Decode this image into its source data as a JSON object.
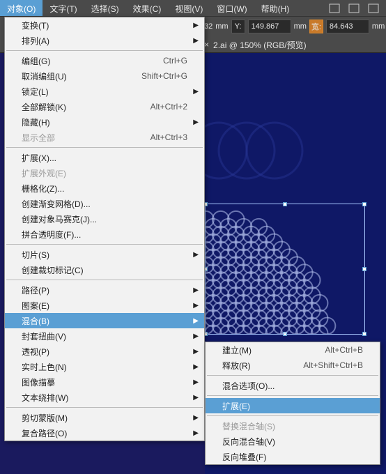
{
  "menubar": {
    "items": [
      {
        "label": "对象(O)",
        "active": true
      },
      {
        "label": "文字(T)"
      },
      {
        "label": "选择(S)"
      },
      {
        "label": "效果(C)"
      },
      {
        "label": "视图(V)"
      },
      {
        "label": "窗口(W)"
      },
      {
        "label": "帮助(H)"
      }
    ]
  },
  "toolbar": {
    "x_suffix": "32",
    "unit": "mm",
    "y_label": "Y:",
    "y_value": "149.867",
    "w_label": "宽:",
    "w_value": "84.643",
    "tab_close": "×",
    "tab_name": "2.ai @ 150% (RGB/预览)"
  },
  "dropdown": {
    "sections": [
      [
        {
          "label": "变换(T)",
          "sub": true
        },
        {
          "label": "排列(A)",
          "sub": true
        }
      ],
      [
        {
          "label": "编组(G)",
          "shortcut": "Ctrl+G"
        },
        {
          "label": "取消编组(U)",
          "shortcut": "Shift+Ctrl+G"
        },
        {
          "label": "锁定(L)",
          "sub": true
        },
        {
          "label": "全部解锁(K)",
          "shortcut": "Alt+Ctrl+2"
        },
        {
          "label": "隐藏(H)",
          "sub": true
        },
        {
          "label": "显示全部",
          "shortcut": "Alt+Ctrl+3",
          "disabled": true
        }
      ],
      [
        {
          "label": "扩展(X)..."
        },
        {
          "label": "扩展外观(E)",
          "disabled": true
        },
        {
          "label": "栅格化(Z)..."
        },
        {
          "label": "创建渐变网格(D)..."
        },
        {
          "label": "创建对象马赛克(J)..."
        },
        {
          "label": "拼合透明度(F)..."
        }
      ],
      [
        {
          "label": "切片(S)",
          "sub": true
        },
        {
          "label": "创建裁切标记(C)"
        }
      ],
      [
        {
          "label": "路径(P)",
          "sub": true
        },
        {
          "label": "图案(E)",
          "sub": true
        },
        {
          "label": "混合(B)",
          "sub": true,
          "highlight": true
        },
        {
          "label": "封套扭曲(V)",
          "sub": true
        },
        {
          "label": "透视(P)",
          "sub": true
        },
        {
          "label": "实时上色(N)",
          "sub": true
        },
        {
          "label": "图像描摹",
          "sub": true
        },
        {
          "label": "文本绕排(W)",
          "sub": true
        }
      ],
      [
        {
          "label": "剪切蒙版(M)",
          "sub": true
        },
        {
          "label": "复合路径(O)",
          "sub": true
        }
      ]
    ]
  },
  "submenu": {
    "sections": [
      [
        {
          "label": "建立(M)",
          "shortcut": "Alt+Ctrl+B"
        },
        {
          "label": "释放(R)",
          "shortcut": "Alt+Shift+Ctrl+B"
        }
      ],
      [
        {
          "label": "混合选项(O)..."
        }
      ],
      [
        {
          "label": "扩展(E)",
          "highlight": true
        }
      ],
      [
        {
          "label": "替换混合轴(S)",
          "disabled": true
        },
        {
          "label": "反向混合轴(V)"
        },
        {
          "label": "反向堆叠(F)"
        }
      ]
    ]
  }
}
